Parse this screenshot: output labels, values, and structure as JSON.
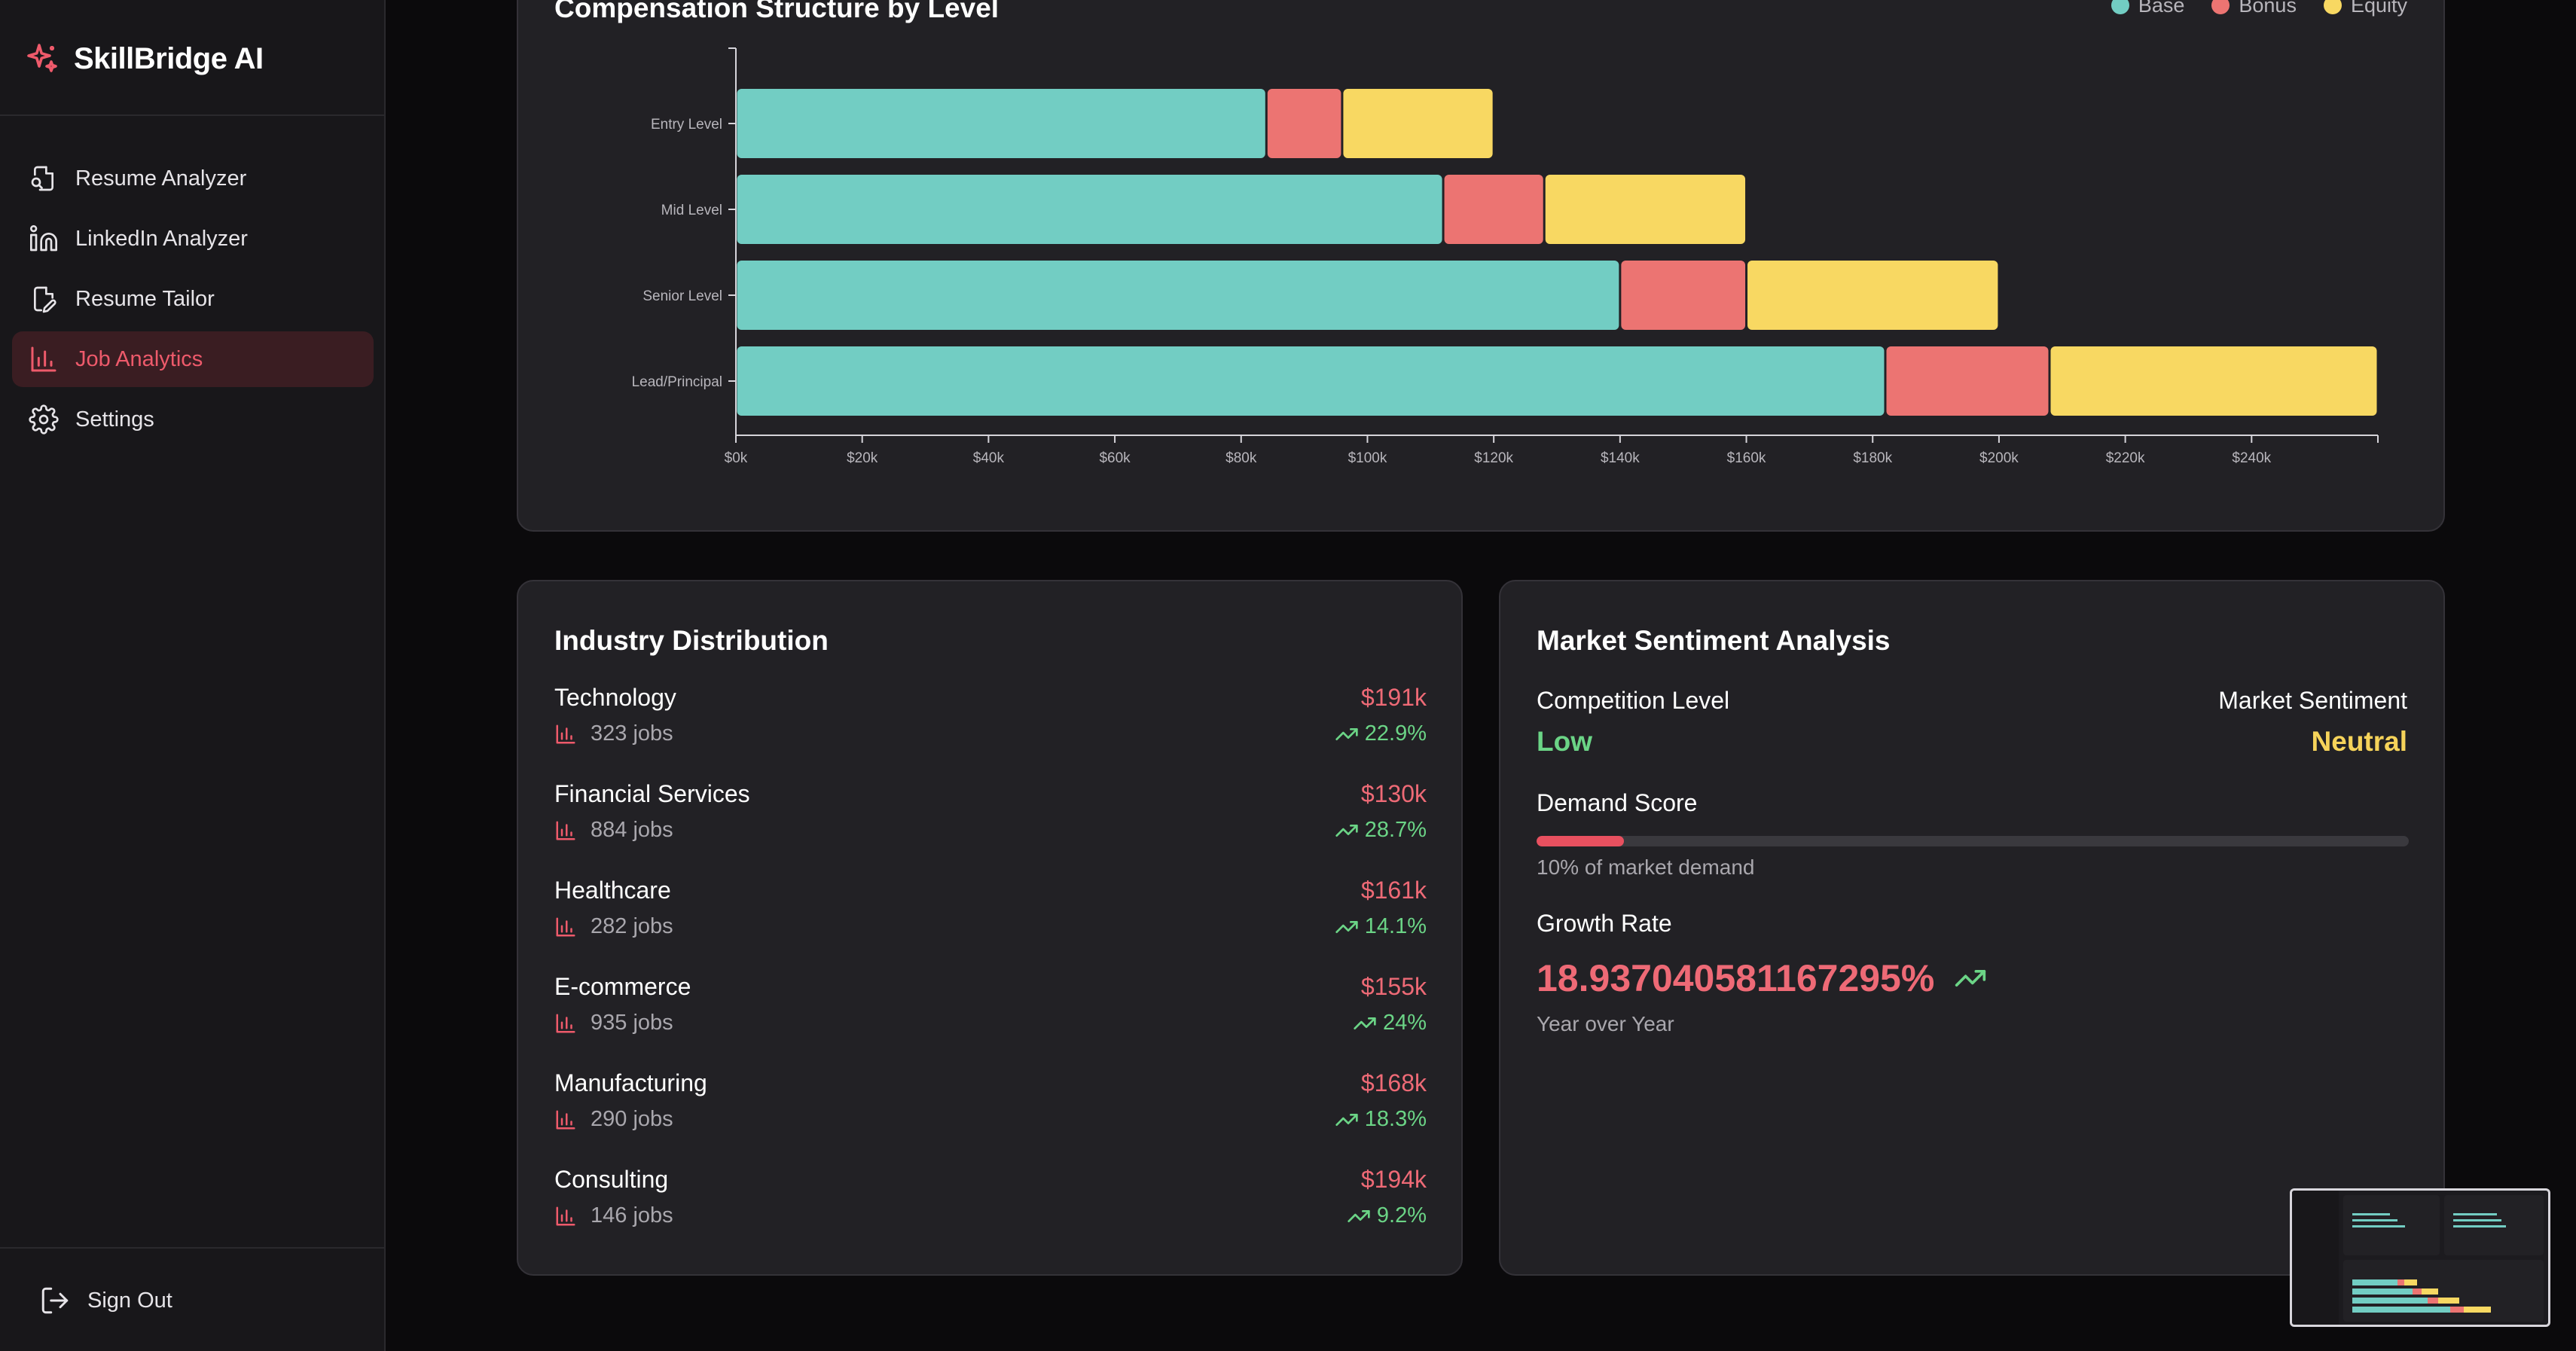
{
  "app": {
    "name": "SkillBridge AI"
  },
  "colors": {
    "accent": "#ee5a6b",
    "base": "#72cdc3",
    "bonus": "#ec7472",
    "equity": "#f8d862",
    "positive": "#6bd486",
    "neutral": "#f6d35a"
  },
  "sidebar": {
    "items": [
      {
        "label": "Resume Analyzer",
        "icon": "file-search-icon",
        "active": false
      },
      {
        "label": "LinkedIn Analyzer",
        "icon": "linkedin-icon",
        "active": false
      },
      {
        "label": "Resume Tailor",
        "icon": "file-edit-icon",
        "active": false
      },
      {
        "label": "Job Analytics",
        "icon": "bar-chart-icon",
        "active": true
      },
      {
        "label": "Settings",
        "icon": "gear-icon",
        "active": false
      }
    ],
    "sign_out": "Sign Out"
  },
  "compensation": {
    "title": "Compensation Structure by Level",
    "legend": [
      "Base",
      "Bonus",
      "Equity"
    ]
  },
  "chart_data": {
    "type": "bar",
    "orientation": "horizontal",
    "stacked": true,
    "categories": [
      "Entry Level",
      "Mid Level",
      "Senior Level",
      "Lead/Principal"
    ],
    "series": [
      {
        "name": "Base",
        "values": [
          84000,
          112000,
          140000,
          182000
        ]
      },
      {
        "name": "Bonus",
        "values": [
          12000,
          16000,
          20000,
          26000
        ]
      },
      {
        "name": "Equity",
        "values": [
          24000,
          32000,
          40000,
          52000
        ]
      }
    ],
    "xticks": [
      "$0k",
      "$20k",
      "$40k",
      "$60k",
      "$80k",
      "$100k",
      "$120k",
      "$140k",
      "$160k",
      "$180k",
      "$200k",
      "$220k",
      "$240k"
    ],
    "xlim": [
      0,
      260000
    ],
    "grid": false,
    "legend_position": "top-right"
  },
  "industry": {
    "title": "Industry Distribution",
    "rows": [
      {
        "name": "Technology",
        "salary": "$191k",
        "jobs": "323 jobs",
        "growth": "22.9%"
      },
      {
        "name": "Financial Services",
        "salary": "$130k",
        "jobs": "884 jobs",
        "growth": "28.7%"
      },
      {
        "name": "Healthcare",
        "salary": "$161k",
        "jobs": "282 jobs",
        "growth": "14.1%"
      },
      {
        "name": "E-commerce",
        "salary": "$155k",
        "jobs": "935 jobs",
        "growth": "24%"
      },
      {
        "name": "Manufacturing",
        "salary": "$168k",
        "jobs": "290 jobs",
        "growth": "18.3%"
      },
      {
        "name": "Consulting",
        "salary": "$194k",
        "jobs": "146 jobs",
        "growth": "9.2%"
      }
    ]
  },
  "market": {
    "title": "Market Sentiment Analysis",
    "competition_label": "Competition Level",
    "competition_value": "Low",
    "sentiment_label": "Market Sentiment",
    "sentiment_value": "Neutral",
    "demand_label": "Demand Score",
    "demand_percent": 10,
    "demand_note": "10% of market demand",
    "growth_label": "Growth Rate",
    "growth_value": "18.937040581167295%",
    "growth_note": "Year over Year"
  }
}
